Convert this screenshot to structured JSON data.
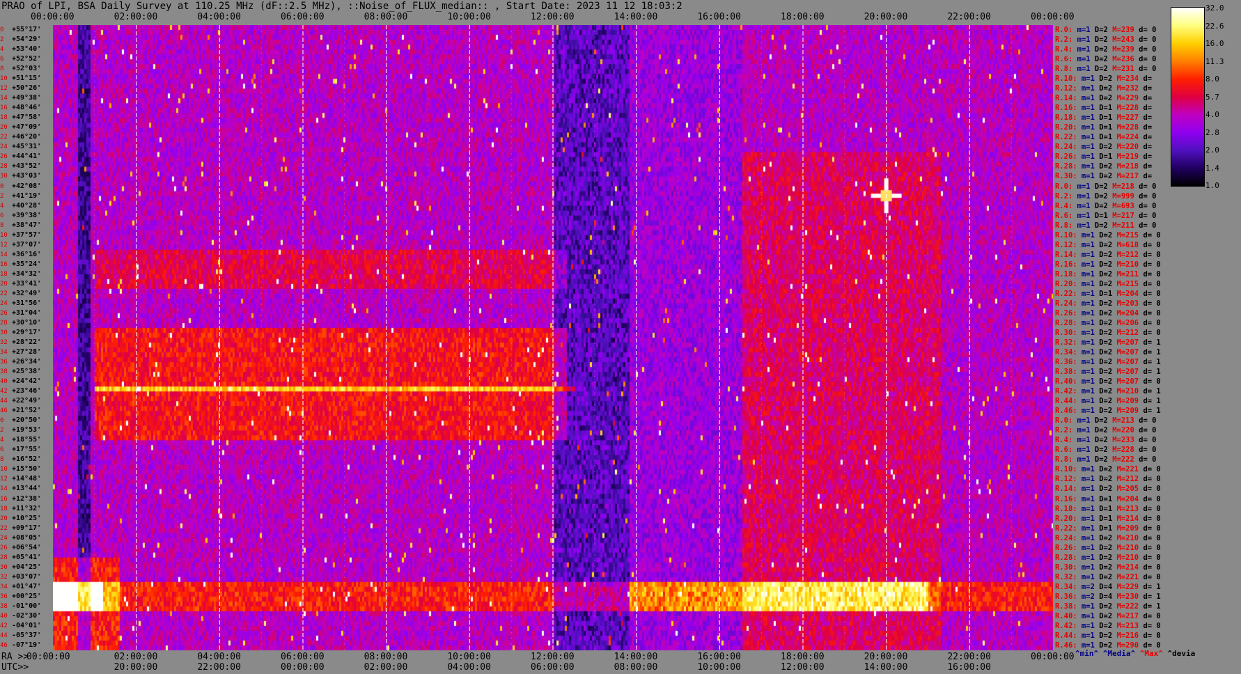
{
  "title": "PRAO of LPI, BSA Daily Survey at 110.25 MHz (dF::2.5 MHz), ::Noise_of_FLUX_median:: , Start Date: 2023 11 12 18:03:2",
  "top_axis": {
    "labels": [
      "00:00:00",
      "02:00:00",
      "04:00:00",
      "06:00:00",
      "08:00:00",
      "10:00:00",
      "12:00:00",
      "14:00:00",
      "16:00:00",
      "18:00:00",
      "20:00:00",
      "22:00:00",
      "00:00:00"
    ]
  },
  "bottom_axis": {
    "ra_prefix": "RA >>",
    "ra_labels": [
      "00:00:00",
      "02:00:00",
      "04:00:00",
      "06:00:00",
      "08:00:00",
      "10:00:00",
      "12:00:00",
      "14:00:00",
      "16:00:00",
      "18:00:00",
      "20:00:00",
      "22:00:00",
      "00:00:00"
    ],
    "utc_prefix": "UTC>>",
    "utc_labels": [
      "20:00:00",
      "22:00:00",
      "00:00:00",
      "02:00:00",
      "04:00:00",
      "06:00:00",
      "08:00:00",
      "10:00:00",
      "12:00:00",
      "14:00:00",
      "16:00:00"
    ]
  },
  "colorbar": {
    "labels": [
      "32.0",
      "22.6",
      "16.0",
      "11.3",
      "8.0",
      "5.7",
      "4.0",
      "2.8",
      "2.0",
      "1.4",
      "1.0"
    ],
    "colors": [
      "#ffffff",
      "#ffff80",
      "#ffd000",
      "#ff8000",
      "#ff2000",
      "#e00040",
      "#c000c0",
      "#9000f0",
      "#5010c0",
      "#200060",
      "#000000"
    ]
  },
  "stats_legend": {
    "min": "^min^",
    "media": "^Media^",
    "max": "^Max^",
    "devia": "^devia"
  },
  "chart_data": {
    "type": "heatmap",
    "title": "PRAO of LPI, BSA Daily Survey at 110.25 MHz (dF::2.5 MHz), ::Noise_of_FLUX_median:: , Start Date: 2023 11 12 18:03:2",
    "x_axis": "RA / UTC (hh:mm:ss)",
    "color_scale": "log",
    "zlim": [
      1.0,
      32.0
    ],
    "rows": [
      {
        "idx": "0",
        "dec": "+55°17'",
        "stat": "R.0: m=1 D=2 M=239 d= 0"
      },
      {
        "idx": "2",
        "dec": "+54°29'",
        "stat": "R.2: m=1 D=2 M=243 d= 0"
      },
      {
        "idx": "4",
        "dec": "+53°40'",
        "stat": "R.4: m=1 D=2 M=239 d= 0"
      },
      {
        "idx": "6",
        "dec": "+52°52'",
        "stat": "R.6: m=1 D=2 M=236 d= 0"
      },
      {
        "idx": "8",
        "dec": "+52°03'",
        "stat": "R.8: m=1 D=2 M=231 d= 0"
      },
      {
        "idx": "10",
        "dec": "+51°15'",
        "stat": "R.10: m=1 D=2 M=234 d="
      },
      {
        "idx": "12",
        "dec": "+50°26'",
        "stat": "R.12: m=1 D=2 M=232 d="
      },
      {
        "idx": "14",
        "dec": "+49°38'",
        "stat": "R.14: m=1 D=2 M=229 d="
      },
      {
        "idx": "16",
        "dec": "+48°46'",
        "stat": "R.16: m=1 D=1 M=228 d="
      },
      {
        "idx": "18",
        "dec": "+47°58'",
        "stat": "R.18: m=1 D=1 M=227 d="
      },
      {
        "idx": "20",
        "dec": "+47°09'",
        "stat": "R.20: m=1 D=1 M=228 d="
      },
      {
        "idx": "22",
        "dec": "+46°20'",
        "stat": "R.22: m=1 D=1 M=224 d="
      },
      {
        "idx": "24",
        "dec": "+45°31'",
        "stat": "R.24: m=1 D=2 M=220 d="
      },
      {
        "idx": "26",
        "dec": "+44°41'",
        "stat": "R.26: m=1 D=1 M=219 d="
      },
      {
        "idx": "28",
        "dec": "+43°52'",
        "stat": "R.28: m=1 D=2 M=218 d="
      },
      {
        "idx": "30",
        "dec": "+43°03'",
        "stat": "R.30: m=1 D=2 M=217 d="
      },
      {
        "idx": "0",
        "dec": "+42°08'",
        "stat": "R.0: m=1 D=2 M=218 d= 0"
      },
      {
        "idx": "2",
        "dec": "+41°19'",
        "stat": "R.2: m=1 D=2 M=999 d= 0"
      },
      {
        "idx": "4",
        "dec": "+40°28'",
        "stat": "R.4: m=1 D=2 M=693 d= 0"
      },
      {
        "idx": "6",
        "dec": "+39°38'",
        "stat": "R.6: m=1 D=1 M=217 d= 0"
      },
      {
        "idx": "8",
        "dec": "+38°47'",
        "stat": "R.8: m=1 D=2 M=211 d= 0"
      },
      {
        "idx": "10",
        "dec": "+37°57'",
        "stat": "R.10: m=1 D=2 M=215 d= 0"
      },
      {
        "idx": "12",
        "dec": "+37°07'",
        "stat": "R.12: m=1 D=2 M=618 d= 0"
      },
      {
        "idx": "14",
        "dec": "+36°16'",
        "stat": "R.14: m=1 D=2 M=212 d= 0"
      },
      {
        "idx": "16",
        "dec": "+35°24'",
        "stat": "R.16: m=1 D=2 M=210 d= 0"
      },
      {
        "idx": "18",
        "dec": "+34°32'",
        "stat": "R.18: m=1 D=2 M=211 d= 0"
      },
      {
        "idx": "20",
        "dec": "+33°41'",
        "stat": "R.20: m=1 D=2 M=215 d= 0"
      },
      {
        "idx": "22",
        "dec": "+32°49'",
        "stat": "R.22: m=1 D=1 M=204 d= 0"
      },
      {
        "idx": "24",
        "dec": "+31°56'",
        "stat": "R.24: m=1 D=2 M=203 d= 0"
      },
      {
        "idx": "26",
        "dec": "+31°04'",
        "stat": "R.26: m=1 D=2 M=204 d= 0"
      },
      {
        "idx": "28",
        "dec": "+30°10'",
        "stat": "R.28: m=1 D=2 M=206 d= 0"
      },
      {
        "idx": "30",
        "dec": "+29°17'",
        "stat": "R.30: m=1 D=2 M=212 d= 0"
      },
      {
        "idx": "32",
        "dec": "+28°22'",
        "stat": "R.32: m=1 D=2 M=207 d= 1"
      },
      {
        "idx": "34",
        "dec": "+27°28'",
        "stat": "R.34: m=1 D=2 M=207 d= 1"
      },
      {
        "idx": "36",
        "dec": "+26°34'",
        "stat": "R.36: m=1 D=2 M=207 d= 1"
      },
      {
        "idx": "38",
        "dec": "+25°38'",
        "stat": "R.38: m=1 D=2 M=207 d= 1"
      },
      {
        "idx": "40",
        "dec": "+24°42'",
        "stat": "R.40: m=1 D=2 M=207 d= 0"
      },
      {
        "idx": "42",
        "dec": "+23°46'",
        "stat": "R.42: m=1 D=2 M=210 d= 1"
      },
      {
        "idx": "44",
        "dec": "+22°49'",
        "stat": "R.44: m=1 D=2 M=209 d= 1"
      },
      {
        "idx": "46",
        "dec": "+21°52'",
        "stat": "R.46: m=1 D=2 M=209 d= 1"
      },
      {
        "idx": "0",
        "dec": "+20°50'",
        "stat": "R.0: m=1 D=2 M=213 d= 0"
      },
      {
        "idx": "2",
        "dec": "+19°53'",
        "stat": "R.2: m=1 D=2 M=220 d= 0"
      },
      {
        "idx": "4",
        "dec": "+18°55'",
        "stat": "R.4: m=1 D=2 M=233 d= 0"
      },
      {
        "idx": "6",
        "dec": "+17°55'",
        "stat": "R.6: m=1 D=2 M=228 d= 0"
      },
      {
        "idx": "8",
        "dec": "+16°52'",
        "stat": "R.8: m=1 D=2 M=222 d= 0"
      },
      {
        "idx": "10",
        "dec": "+15°50'",
        "stat": "R.10: m=1 D=2 M=221 d= 0"
      },
      {
        "idx": "12",
        "dec": "+14°48'",
        "stat": "R.12: m=1 D=2 M=212 d= 0"
      },
      {
        "idx": "14",
        "dec": "+13°44'",
        "stat": "R.14: m=1 D=2 M=205 d= 0"
      },
      {
        "idx": "16",
        "dec": "+12°38'",
        "stat": "R.16: m=1 D=1 M=204 d= 0"
      },
      {
        "idx": "18",
        "dec": "+11°32'",
        "stat": "R.18: m=1 D=1 M=213 d= 0"
      },
      {
        "idx": "20",
        "dec": "+10°25'",
        "stat": "R.20: m=1 D=1 M=214 d= 0"
      },
      {
        "idx": "22",
        "dec": "+09°17'",
        "stat": "R.22: m=1 D=1 M=209 d= 0"
      },
      {
        "idx": "24",
        "dec": "+08°05'",
        "stat": "R.24: m=1 D=2 M=210 d= 0"
      },
      {
        "idx": "26",
        "dec": "+06°54'",
        "stat": "R.26: m=1 D=2 M=210 d= 0"
      },
      {
        "idx": "28",
        "dec": "+05°41'",
        "stat": "R.28: m=1 D=2 M=210 d= 0"
      },
      {
        "idx": "30",
        "dec": "+04°25'",
        "stat": "R.30: m=1 D=2 M=214 d= 0"
      },
      {
        "idx": "32",
        "dec": "+03°07'",
        "stat": "R.32: m=1 D=2 M=221 d= 0"
      },
      {
        "idx": "34",
        "dec": "+01°47'",
        "stat": "R.34: m=2 D=4 M=229 d= 1"
      },
      {
        "idx": "36",
        "dec": "+00°25'",
        "stat": "R.36: m=2 D=4 M=230 d= 1"
      },
      {
        "idx": "38",
        "dec": "-01°00'",
        "stat": "R.38: m=1 D=2 M=222 d= 1"
      },
      {
        "idx": "40",
        "dec": "-02°30'",
        "stat": "R.40: m=1 D=2 M=217 d= 0"
      },
      {
        "idx": "42",
        "dec": "-04°01'",
        "stat": "R.42: m=1 D=2 M=213 d= 0"
      },
      {
        "idx": "44",
        "dec": "-05°37'",
        "stat": "R.44: m=1 D=2 M=216 d= 0"
      },
      {
        "idx": "46",
        "dec": "-07°19'",
        "stat": "R.46: m=1 D=2 M=290 d= 0"
      }
    ],
    "bright_features": [
      {
        "ra_h": 20.0,
        "dec": "+40°28'",
        "note": "bright point source"
      },
      {
        "ra_h": 1.0,
        "dec": "+00°25'",
        "note": "bright band"
      },
      {
        "ra_h": 19.0,
        "dec": "+00°25'",
        "note": "bright band"
      }
    ]
  }
}
